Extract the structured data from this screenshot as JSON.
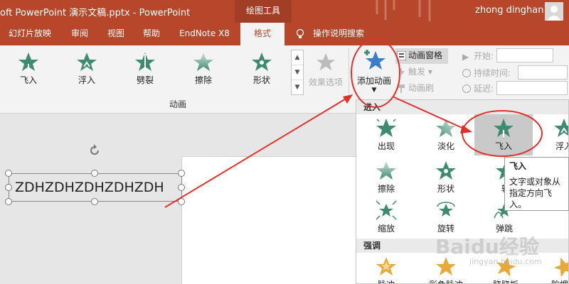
{
  "titlebar": {
    "title": "oft PowerPoint 演示文稿.pptx  -  PowerPoint",
    "context_tab": "绘图工具",
    "user": "zhong dinghan"
  },
  "tabs": [
    {
      "label": "幻灯片放映"
    },
    {
      "label": "审阅"
    },
    {
      "label": "视图"
    },
    {
      "label": "帮助"
    },
    {
      "label": "EndNote X8"
    },
    {
      "label": "格式"
    }
  ],
  "tell_me": "操作说明搜索",
  "ribbon": {
    "animations": [
      {
        "label": "飞入",
        "icon": "fly-in-star-icon"
      },
      {
        "label": "浮入",
        "icon": "float-in-star-icon"
      },
      {
        "label": "劈裂",
        "icon": "split-star-icon"
      },
      {
        "label": "擦除",
        "icon": "wipe-star-icon"
      },
      {
        "label": "形状",
        "icon": "shape-star-icon"
      }
    ],
    "effect_options": "效果选项",
    "group_label": "动画",
    "add_animation": "添加动画",
    "animation_pane": "动画窗格",
    "trigger": "触发",
    "animation_painter": "动画刷",
    "timing": {
      "start": "开始:",
      "duration": "持续时间:",
      "delay": "延迟:"
    }
  },
  "slide": {
    "textbox_text": "ZDHZDHZDHZDHZDH"
  },
  "panel": {
    "sections": {
      "entrance": "进入",
      "emphasis": "强调"
    },
    "entrance_items": [
      {
        "label": "出现",
        "icon": "appear-star-icon"
      },
      {
        "label": "淡化",
        "icon": "fade-star-icon"
      },
      {
        "label": "飞入",
        "icon": "fly-in-star-icon"
      },
      {
        "label": "浮入",
        "icon": "float-in-star-icon"
      },
      {
        "label": "擦除",
        "icon": "wipe-star-icon"
      },
      {
        "label": "形状",
        "icon": "shape-star-icon"
      },
      {
        "label": "轮",
        "icon": "wheel-star-icon"
      },
      {
        "label": "缩放",
        "icon": "zoom-star-icon"
      },
      {
        "label": "旋转",
        "icon": "swivel-star-icon"
      },
      {
        "label": "弹跳",
        "icon": "bounce-star-icon"
      }
    ],
    "emphasis_items": [
      {
        "label": "脉冲",
        "icon": "pulse-star-icon"
      },
      {
        "label": "彩色脉冲",
        "icon": "color-pulse-star-icon"
      },
      {
        "label": "跷跷板",
        "icon": "teeter-star-icon"
      },
      {
        "label": "陀螺旋",
        "icon": "spin-star-icon"
      }
    ]
  },
  "tooltip": {
    "title": "飞入",
    "body": "文字或对象从指定方向飞入。"
  },
  "watermark": {
    "text": "Baidu经验",
    "url": "jingyan.baidu.com"
  },
  "colors": {
    "ppt_red": "#b7472a",
    "anim_green": "#3e8a73",
    "emph_gold": "#e8a83a",
    "annotation_red": "#e0302a"
  }
}
